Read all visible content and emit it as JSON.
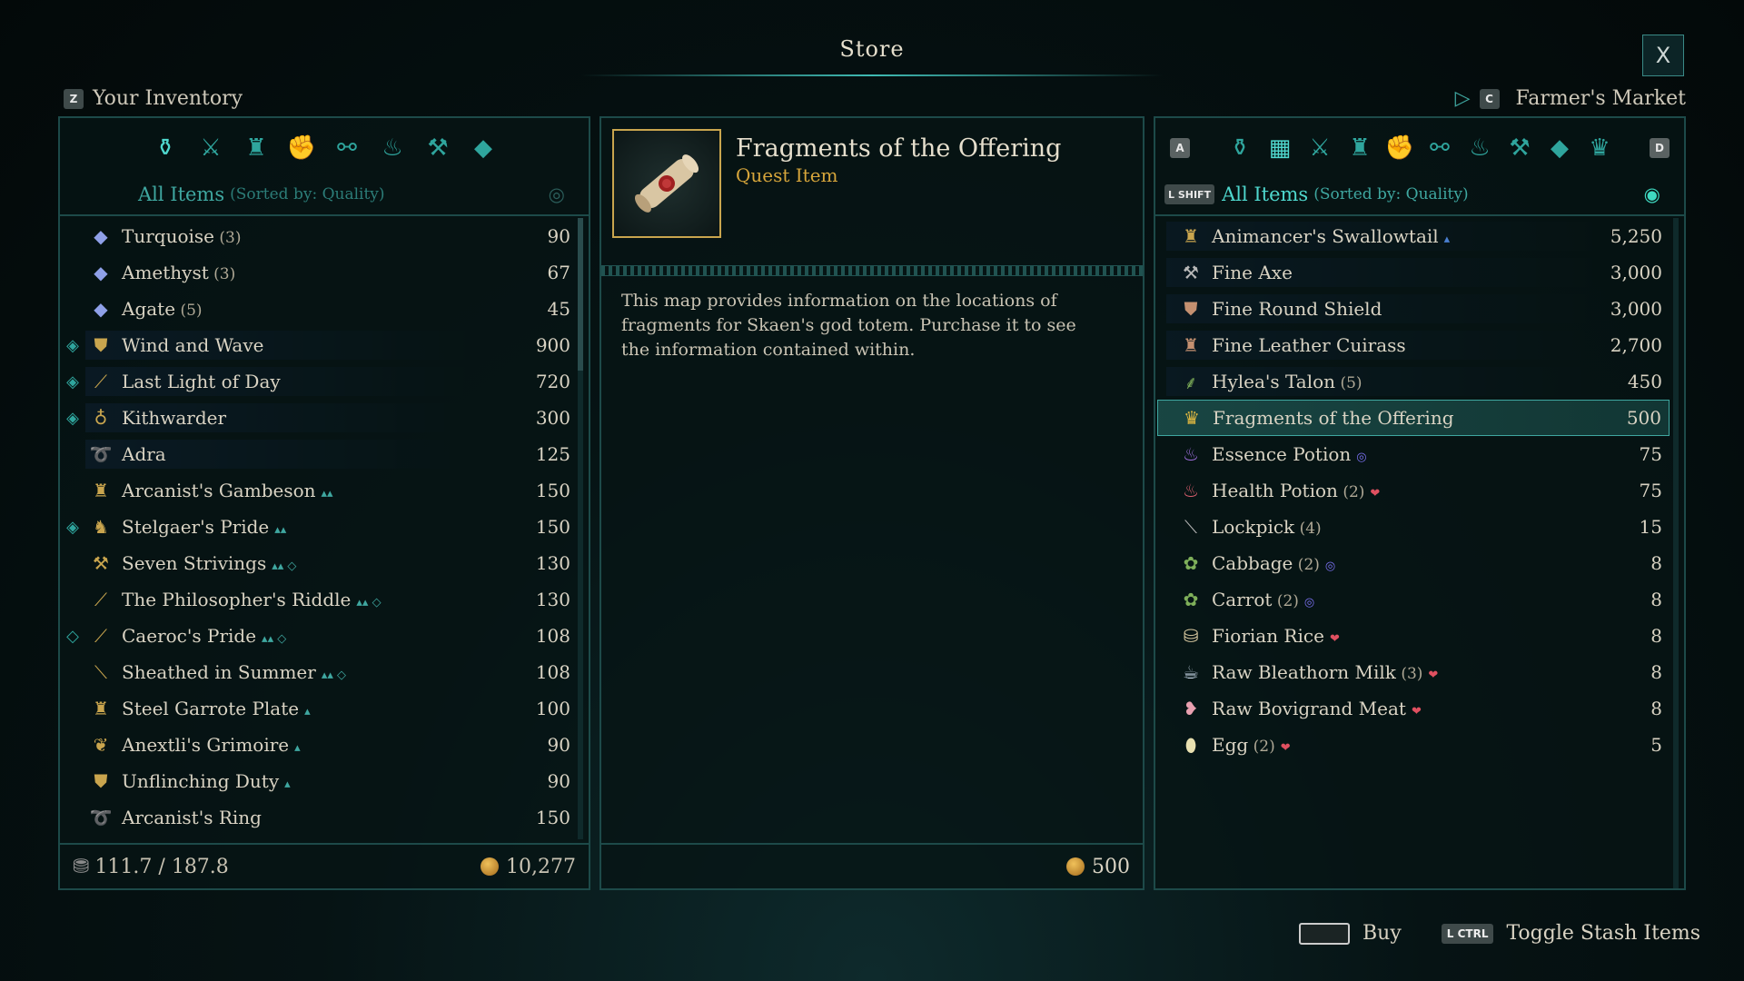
{
  "window": {
    "title": "Store",
    "close_label": "X"
  },
  "left": {
    "key": "Z",
    "label": "Your Inventory",
    "tabs": [
      "bag-icon",
      "sword-icon",
      "armor-icon",
      "gauntlet-icon",
      "rings-icon",
      "potion-icon",
      "anvil-icon",
      "gem-icon"
    ],
    "sort_label": "All Items",
    "sort_sub": "(Sorted by: Quality)",
    "items": [
      {
        "name": "Turquoise",
        "qty": "(3)",
        "price": "90",
        "icon": "◆",
        "color": "#8fa0e8",
        "mark": ""
      },
      {
        "name": "Amethyst",
        "qty": "(3)",
        "price": "67",
        "icon": "◆",
        "color": "#8fa0e8",
        "mark": ""
      },
      {
        "name": "Agate",
        "qty": "(5)",
        "price": "45",
        "icon": "◆",
        "color": "#8fa0e8",
        "mark": ""
      },
      {
        "name": "Wind and Wave",
        "qty": "",
        "price": "900",
        "icon": "⛊",
        "color": "#c9a54e",
        "mark": "◈",
        "hl": true
      },
      {
        "name": "Last Light of Day",
        "qty": "",
        "price": "720",
        "icon": "⟋",
        "color": "#c9a54e",
        "mark": "◈",
        "hl": true
      },
      {
        "name": "Kithwarder",
        "qty": "",
        "price": "300",
        "icon": "♁",
        "color": "#c9a54e",
        "mark": "◈",
        "hl": true
      },
      {
        "name": "Adra",
        "qty": "",
        "price": "125",
        "icon": "➰",
        "color": "#c9a54e",
        "mark": "",
        "hl": true
      },
      {
        "name": "Arcanist's Gambeson",
        "qty": "",
        "price": "150",
        "icon": "♜",
        "color": "#c9a54e",
        "mark": "",
        "extra": "▴▴"
      },
      {
        "name": "Stelgaer's Pride",
        "qty": "",
        "price": "150",
        "icon": "♞",
        "color": "#c9a54e",
        "mark": "◈",
        "extra": "▴▴"
      },
      {
        "name": "Seven Strivings",
        "qty": "",
        "price": "130",
        "icon": "⚒",
        "color": "#c9a54e",
        "mark": "",
        "extra": "▴▴ ◇"
      },
      {
        "name": "The Philosopher's Riddle",
        "qty": "",
        "price": "130",
        "icon": "⟋",
        "color": "#c9a54e",
        "mark": "",
        "extra": "▴▴ ◇"
      },
      {
        "name": "Caeroc's Pride",
        "qty": "",
        "price": "108",
        "icon": "⟋",
        "color": "#c9a54e",
        "mark": "◇",
        "extra": "▴▴ ◇"
      },
      {
        "name": "Sheathed in Summer",
        "qty": "",
        "price": "108",
        "icon": "⟍",
        "color": "#c9a54e",
        "mark": "",
        "extra": "▴▴ ◇"
      },
      {
        "name": "Steel Garrote Plate",
        "qty": "",
        "price": "100",
        "icon": "♜",
        "color": "#c9a54e",
        "mark": "",
        "extra": "▴"
      },
      {
        "name": "Anextli's Grimoire",
        "qty": "",
        "price": "90",
        "icon": "❦",
        "color": "#c9a54e",
        "mark": "",
        "extra": "▴"
      },
      {
        "name": "Unflinching Duty",
        "qty": "",
        "price": "90",
        "icon": "⛊",
        "color": "#c9a54e",
        "mark": "",
        "extra": "▴"
      },
      {
        "name": "Arcanist's Ring",
        "qty": "",
        "price": "150",
        "icon": "➰",
        "color": "#c9a54e",
        "mark": ""
      }
    ],
    "weight": "111.7 / 187.8",
    "gold": "10,277"
  },
  "detail": {
    "name": "Fragments of the Offering",
    "type": "Quest Item",
    "description": "This map provides information on the locations of fragments for Skaen's god totem. Purchase it to see the information contained within.",
    "price": "500"
  },
  "right": {
    "key": "C",
    "label": "Farmer's Market",
    "key_a": "A",
    "key_d": "D",
    "key_shift": "L SHIFT",
    "tabs": [
      "bag-icon",
      "chest-icon",
      "sword-icon",
      "armor-icon",
      "gauntlet-icon",
      "rings-icon",
      "potion-icon",
      "anvil-icon",
      "gem-icon",
      "crown-icon"
    ],
    "sort_label": "All Items",
    "sort_sub": "(Sorted by: Quality)",
    "items": [
      {
        "name": "Animancer's Swallowtail",
        "qty": "",
        "price": "5,250",
        "icon": "♜",
        "color": "#c9a54e",
        "extra": "▴",
        "extra_color": "#4a7fd0",
        "hl": true
      },
      {
        "name": "Fine Axe",
        "qty": "",
        "price": "3,000",
        "icon": "⚒",
        "color": "#b8b8b8",
        "hl": true
      },
      {
        "name": "Fine Round Shield",
        "qty": "",
        "price": "3,000",
        "icon": "⛊",
        "color": "#c49070",
        "hl": true
      },
      {
        "name": "Fine Leather Cuirass",
        "qty": "",
        "price": "2,700",
        "icon": "♜",
        "color": "#c49070",
        "hl": true
      },
      {
        "name": "Hylea's Talon",
        "qty": "(5)",
        "price": "450",
        "icon": "⸙",
        "color": "#7fb05a",
        "hl": true
      },
      {
        "name": "Fragments of the Offering",
        "qty": "",
        "price": "500",
        "icon": "♛",
        "color": "#e0b840",
        "selected": true
      },
      {
        "name": "Essence Potion",
        "qty": "",
        "price": "75",
        "icon": "♨",
        "color": "#a070e0",
        "extra": "◎",
        "extra_color": "#7a70f0"
      },
      {
        "name": "Health Potion",
        "qty": "(2)",
        "price": "75",
        "icon": "♨",
        "color": "#e06070",
        "extra": "❤",
        "extra_color": "#e05060"
      },
      {
        "name": "Lockpick",
        "qty": "(4)",
        "price": "15",
        "icon": "⟍",
        "color": "#b8b8b8"
      },
      {
        "name": "Cabbage",
        "qty": "(2)",
        "price": "8",
        "icon": "✿",
        "color": "#7fb05a",
        "extra": "◎",
        "extra_color": "#7a70f0"
      },
      {
        "name": "Carrot",
        "qty": "(2)",
        "price": "8",
        "icon": "✿",
        "color": "#7fb05a",
        "extra": "◎",
        "extra_color": "#7a70f0"
      },
      {
        "name": "Fiorian Rice",
        "qty": "",
        "price": "8",
        "icon": "⛁",
        "color": "#d8c8a0",
        "extra": "❤",
        "extra_color": "#e05060"
      },
      {
        "name": "Raw Bleathorn Milk",
        "qty": "(3)",
        "price": "8",
        "icon": "☕",
        "color": "#c8d8e8",
        "extra": "❤",
        "extra_color": "#e05060"
      },
      {
        "name": "Raw Bovigrand Meat",
        "qty": "",
        "price": "8",
        "icon": "❥",
        "color": "#e8a0b0",
        "extra": "❤",
        "extra_color": "#e05060"
      },
      {
        "name": "Egg",
        "qty": "(2)",
        "price": "5",
        "icon": "⬮",
        "color": "#e8e0b0",
        "extra": "❤",
        "extra_color": "#e05060"
      }
    ]
  },
  "hints": {
    "buy": "Buy",
    "ctrl_key": "L CTRL",
    "toggle": "Toggle Stash Items"
  }
}
